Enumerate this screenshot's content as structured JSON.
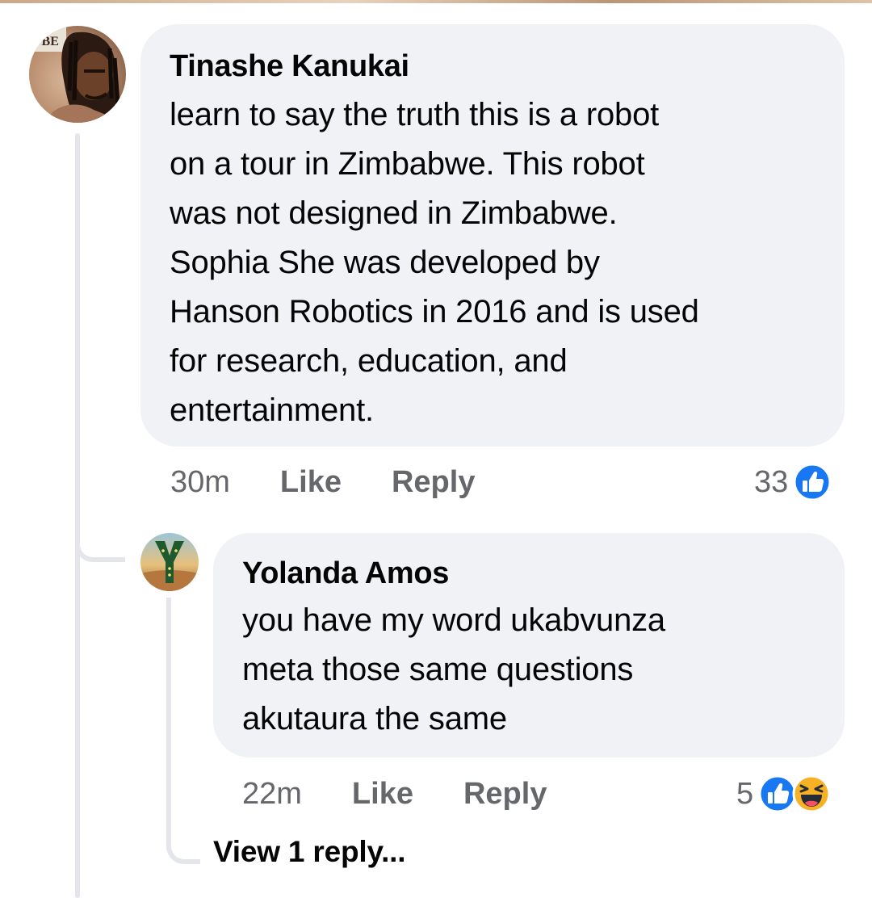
{
  "comment": {
    "author": "Tinashe Kanukai",
    "avatar_text": "UBE",
    "lines": [
      "learn to say the truth this is a robot",
      "on a tour in Zimbabwe. This robot",
      "was not designed in Zimbabwe.",
      "Sophia She was developed by",
      "Hanson Robotics in 2016 and is used",
      "for research, education, and",
      "entertainment."
    ],
    "time": "30m",
    "like_label": "Like",
    "reply_label": "Reply",
    "reaction_count": "33",
    "reactions": [
      "like-icon"
    ]
  },
  "reply": {
    "author": "Yolanda Amos",
    "lines": [
      "you have my word ukabvunza",
      "meta those same questions",
      "akutaura the same"
    ],
    "time": "22m",
    "like_label": "Like",
    "reply_label": "Reply",
    "reaction_count": "5",
    "reactions": [
      "like-icon",
      "haha-icon"
    ]
  },
  "view_replies_label": "View 1 reply...",
  "colors": {
    "bubble": "#f0f2f5",
    "meta_text": "#65676b",
    "like_blue": "#1877f2",
    "haha_yellow": "#f7b125",
    "thread_line": "#e4e6eb"
  }
}
